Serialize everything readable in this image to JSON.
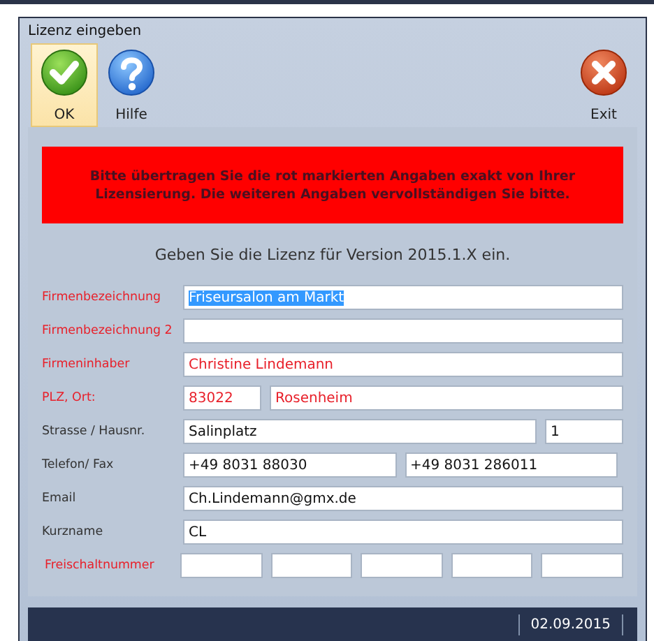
{
  "window": {
    "title": "Lizenz eingeben"
  },
  "toolbar": [
    {
      "label": "OK",
      "kind": "confirm",
      "selected": true
    },
    {
      "label": "Hilfe",
      "kind": "help",
      "selected": false
    },
    {
      "label": "Exit",
      "kind": "exit",
      "selected": false
    }
  ],
  "banner": "Bitte übertragen Sie die rot markierten Angaben exakt von Ihrer Lizensierung. Die weiteren Angaben vervollständigen Sie bitte.",
  "prompt": "Geben Sie die Lizenz für Version 2015.1.X ein.",
  "fields": [
    {
      "label": "Firmenbezeichnung",
      "required": true,
      "kind": "single",
      "inputs": [
        {
          "kind": "text",
          "value": "Friseursalon am Markt",
          "text_selected": true
        }
      ]
    },
    {
      "label": "Firmenbezeichnung 2",
      "required": true,
      "kind": "single",
      "inputs": [
        {
          "kind": "text"
        }
      ]
    },
    {
      "label": "Firmeninhaber",
      "required": true,
      "kind": "single",
      "inputs": [
        {
          "kind": "text",
          "value": "Christine Lindemann"
        }
      ]
    },
    {
      "label": "PLZ, Ort:",
      "required": true,
      "kind": "zip_city",
      "inputs": [
        {
          "kind": "text",
          "value": "83022"
        },
        {
          "kind": "text",
          "value": "Rosenheim"
        }
      ]
    },
    {
      "label": "Strasse / Hausnr.",
      "required": false,
      "kind": "street",
      "inputs": [
        {
          "kind": "text",
          "value": "Salinplatz"
        },
        {
          "kind": "text",
          "value": "1"
        }
      ]
    },
    {
      "label": "Telefon/ Fax",
      "required": false,
      "kind": "phone",
      "inputs": [
        {
          "kind": "text",
          "value": "+49 8031 88030"
        },
        {
          "kind": "text",
          "value": "+49 8031 286011"
        }
      ]
    },
    {
      "label": "Email",
      "required": false,
      "kind": "single",
      "inputs": [
        {
          "kind": "text",
          "value": "Ch.Lindemann@gmx.de"
        }
      ]
    },
    {
      "label": "Kurzname",
      "required": false,
      "kind": "single",
      "inputs": [
        {
          "kind": "text",
          "value": "CL"
        }
      ]
    },
    {
      "label": "Freischaltnummer",
      "required": true,
      "kind": "code",
      "inputs": [
        {
          "kind": "text"
        },
        {
          "kind": "text"
        },
        {
          "kind": "text"
        },
        {
          "kind": "text"
        },
        {
          "kind": "text"
        }
      ]
    }
  ],
  "status_bar": {
    "date": "02.09.2015"
  }
}
